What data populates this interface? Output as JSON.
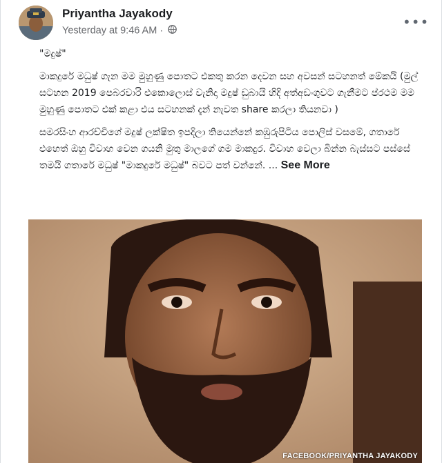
{
  "post": {
    "author": "Priyantha Jayakody",
    "timestamp": "Yesterday at 9:46 AM",
    "separator": "·",
    "privacy_icon": "globe-icon",
    "more_icon": "more-options-icon",
    "paragraphs": [
      "\"මදුෂ්\"",
      "මාකදුරේ මධුෂ් ගැන මම මුහුණු පොතට එකතු කරන දෙවන සහ අවසන් සටහනත් මේකයි (මුල් සටහන 2019 පෙබරවාරි එකොලොස් වැනිදා මදුෂ් ඩුබායි හිදි අත්අඩංගුවට ගැනීමට ප්රථම මම මුහුණු පොතට එක් කළා එය සටහනක් දැන් නැවත share කරලා තියනවා )",
      "සමරසිංහ ආරච්චිගේ මදුෂ් ලක්ෂිත ඉපදිලා තියෙන්නේ කඹුරුපිටිය පොලිස් වසමේ, ගතාරේ එහෙත් ඔහු විවාහ වෙන ගයනි මුතු මාලගේ ගම මාකදුර. විවාහ වෙලා බින්න බැස්සට පස්සේ තමයි ගතාරේ මධුෂ් \"මාකදුරේ මධුෂ්\" බවට පත් වන්නේ. ..."
    ],
    "see_more": "See More"
  },
  "photo": {
    "caption": "FACEBOOK/PRIYANTHA JAYAKODY"
  }
}
